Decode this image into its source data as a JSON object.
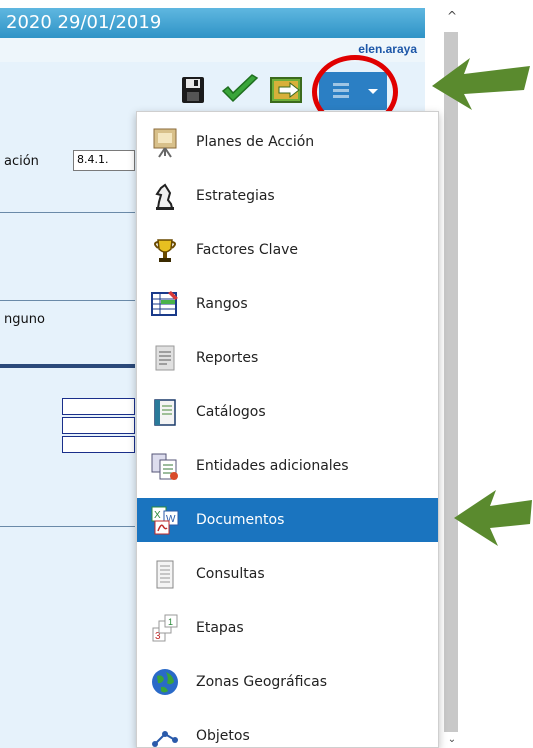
{
  "header": {
    "date_text": "2020 29/01/2019",
    "user": "elen.araya"
  },
  "form": {
    "label_code": "ación",
    "code_value": "8.4.1.",
    "label_none": "nguno"
  },
  "toolbar": {
    "save_icon": "floppy-disk-icon",
    "check_icon": "green-check-icon",
    "export_icon": "export-arrow-icon",
    "menu_icon": "list-menu-icon"
  },
  "menu": {
    "items": [
      {
        "label": "Planes de Acción",
        "icon": "presentation-board-icon"
      },
      {
        "label": "Estrategias",
        "icon": "chess-knight-icon"
      },
      {
        "label": "Factores Clave",
        "icon": "trophy-icon"
      },
      {
        "label": "Rangos",
        "icon": "ranges-table-icon"
      },
      {
        "label": "Reportes",
        "icon": "report-document-icon"
      },
      {
        "label": "Catálogos",
        "icon": "catalog-book-icon"
      },
      {
        "label": "Entidades adicionales",
        "icon": "entities-icon"
      },
      {
        "label": "Documentos",
        "icon": "office-documents-icon"
      },
      {
        "label": "Consultas",
        "icon": "query-document-icon"
      },
      {
        "label": "Etapas",
        "icon": "stages-icon"
      },
      {
        "label": "Zonas Geográficas",
        "icon": "globe-icon"
      },
      {
        "label": "Objetos",
        "icon": "objects-icon"
      }
    ],
    "active_index": 7
  },
  "annotations": {
    "arrow_color": "#5a8a2e",
    "circle_color": "#e00000"
  },
  "colors": {
    "header_blue": "#2f93c6",
    "menu_active": "#1a74bf",
    "toggle_blue": "#2b7fc4"
  }
}
